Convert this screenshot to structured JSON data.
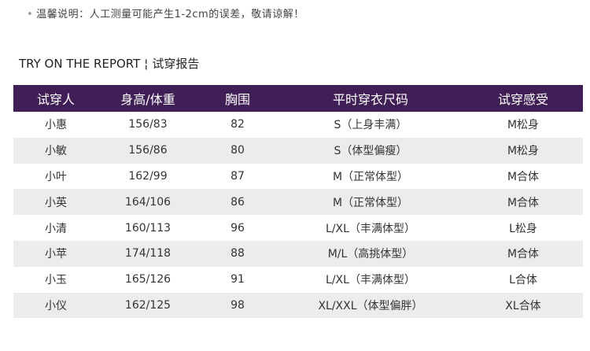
{
  "note": {
    "bullet": "•",
    "text": "温馨说明：人工测量可能产生1-2cm的误差，敬请谅解！"
  },
  "heading": {
    "en": "TRY ON THE REPORT",
    "sep": "¦",
    "zh": "试穿报告"
  },
  "table": {
    "columns": [
      "试穿人",
      "身高/体重",
      "胸围",
      "平时穿衣尺码",
      "试穿感受"
    ],
    "rows": [
      [
        "小惠",
        "156/83",
        "82",
        "S（上身丰满）",
        "M松身"
      ],
      [
        "小敏",
        "156/86",
        "80",
        "S（体型偏瘦）",
        "M松身"
      ],
      [
        "小叶",
        "162/99",
        "87",
        "M（正常体型）",
        "M合体"
      ],
      [
        "小英",
        "164/106",
        "86",
        "M（正常体型）",
        "M合体"
      ],
      [
        "小清",
        "160/113",
        "96",
        "L/XL（丰满体型）",
        "L松身"
      ],
      [
        "小苹",
        "174/118",
        "88",
        "M/L（高挑体型）",
        "M合体"
      ],
      [
        "小玉",
        "165/126",
        "91",
        "L/XL（丰满体型）",
        "L合体"
      ],
      [
        "小仪",
        "162/125",
        "98",
        "XL/XXL（体型偏胖）",
        "XL合体"
      ]
    ]
  }
}
